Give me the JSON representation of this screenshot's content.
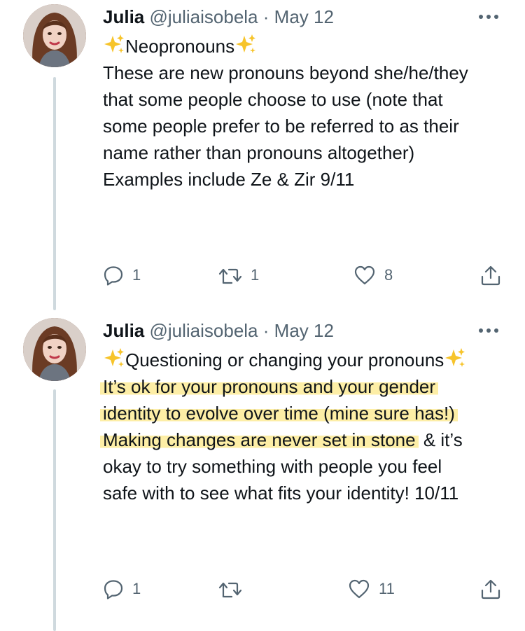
{
  "tweets": [
    {
      "author_name": "Julia",
      "handle": "@juliaisobela",
      "separator": "·",
      "date": "May 12",
      "more_label": "More",
      "title": "Neopronouns",
      "lines": [
        "These are new pronouns beyond she/he/they",
        "that some people choose to use (note that",
        "some people prefer to be referred to as their",
        "name rather than pronouns altogether)"
      ],
      "closing": "Examples include Ze & Zir 9/11",
      "replies": "1",
      "retweets": "1",
      "likes": "8"
    },
    {
      "author_name": "Julia",
      "handle": "@juliaisobela",
      "separator": "·",
      "date": "May 12",
      "more_label": "More",
      "title": "Questioning or changing your pronouns",
      "highlight_lines": [
        "It’s ok for your pronouns and your gender",
        "identity to evolve over time (mine sure has!)"
      ],
      "para2_highlight": "Making changes are never set in stone",
      "para2_rest_first": " & it’s",
      "para2_lines": [
        "okay to try something with people you feel",
        "safe with to see what fits your identity! 10/11"
      ],
      "replies": "1",
      "retweets": "",
      "likes": "11"
    }
  ],
  "icons": {
    "sparkle": "sparkles-icon",
    "reply": "reply-icon",
    "retweet": "retweet-icon",
    "like": "heart-icon",
    "share": "share-icon",
    "more": "ellipsis-icon"
  },
  "colors": {
    "highlight": "#fdeea6",
    "secondary_text": "#536471",
    "thread_line": "#cfd9de",
    "sparkle": "#f7c42b"
  }
}
